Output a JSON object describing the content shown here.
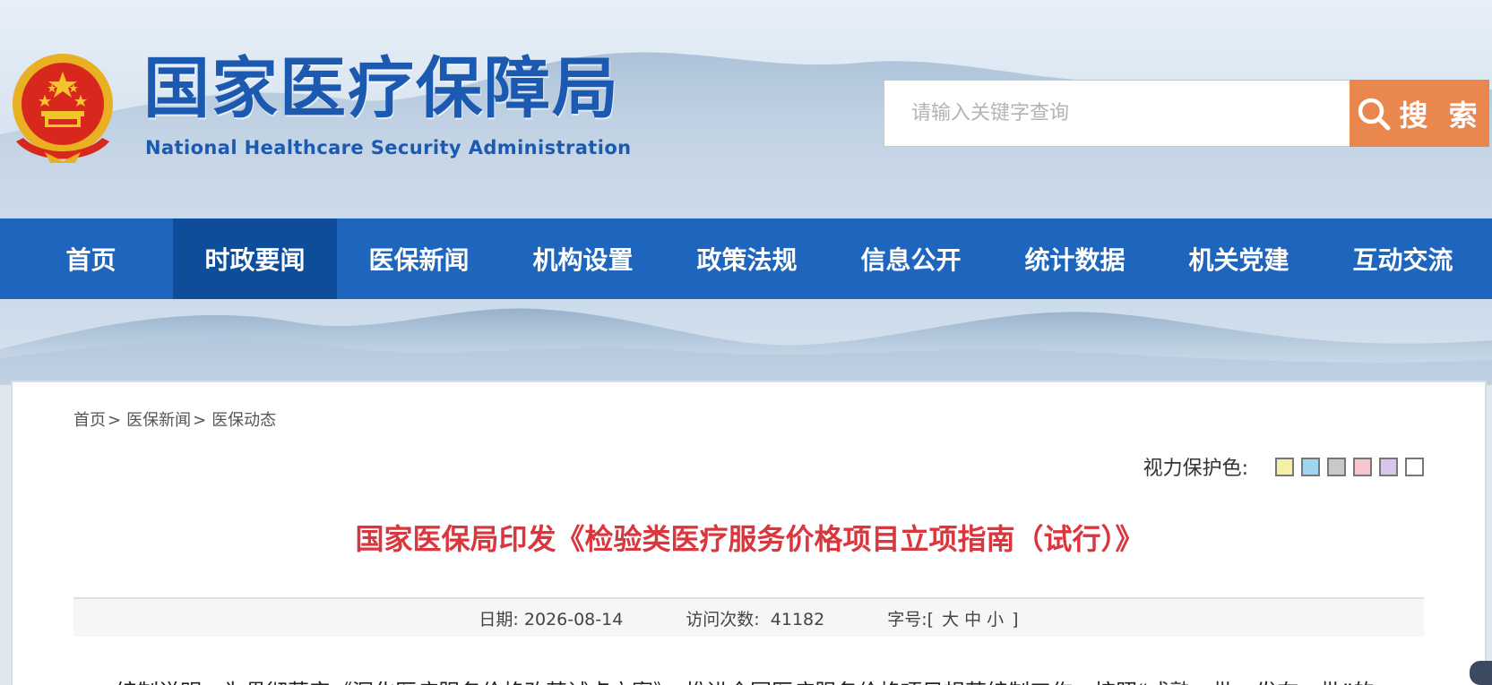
{
  "header": {
    "title": "国家医疗保障局",
    "subtitle": "National Healthcare Security Administration"
  },
  "search": {
    "placeholder": "请输入关键字查询",
    "button_label": "搜 索"
  },
  "nav": {
    "items": [
      {
        "label": "首页"
      },
      {
        "label": "时政要闻"
      },
      {
        "label": "医保新闻"
      },
      {
        "label": "机构设置"
      },
      {
        "label": "政策法规"
      },
      {
        "label": "信息公开"
      },
      {
        "label": "统计数据"
      },
      {
        "label": "机关党建"
      },
      {
        "label": "互动交流"
      }
    ],
    "active_index": 1
  },
  "breadcrumb": {
    "items": [
      "首页",
      "医保新闻",
      "医保动态"
    ],
    "separator": ">"
  },
  "eye_protection": {
    "label": "视力保护色:",
    "swatches": [
      "#f5f1a4",
      "#9fd6ef",
      "#c9c9c9",
      "#f5c6d0",
      "#dcc4ef",
      "#ffffff"
    ]
  },
  "article": {
    "title": "国家医保局印发《检验类医疗服务价格项目立项指南（试行）》",
    "date_label": "日期:",
    "date": "2026-08-14",
    "views_label": "访问次数:",
    "views": "41182",
    "font_size_label": "字号:",
    "font_sizes": [
      "大",
      "中",
      "小"
    ],
    "body_first_line": "编制说明：为贯彻落实《深化医疗服务价格改革试点方案》，推进全国医疗服务价格项目规范编制工作，按照“成熟一批、发布一批”的"
  },
  "colors": {
    "nav_bg": "#1e66bd",
    "nav_active": "#0d4d9a",
    "search_button": "#e9874f",
    "title_red": "#d9363e",
    "brand_blue": "#1b5ab0"
  }
}
